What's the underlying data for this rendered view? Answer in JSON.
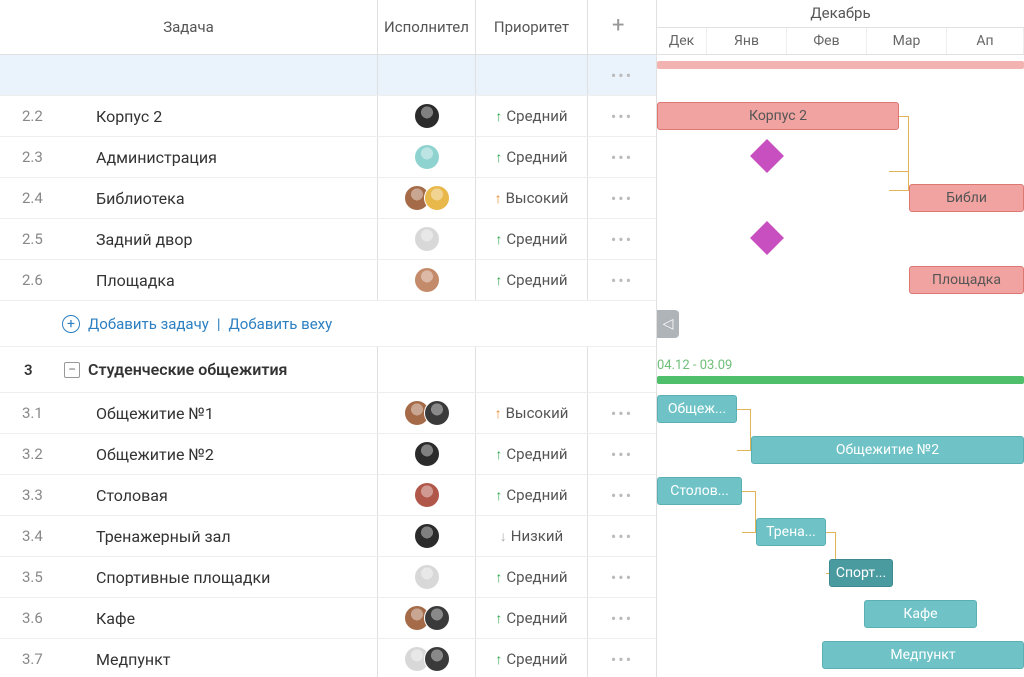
{
  "header": {
    "task": "Задача",
    "assignee": "Исполнител",
    "priority": "Приоритет",
    "month_group": "Декабрь",
    "months": [
      "Дек",
      "Янв",
      "Фев",
      "Мар",
      "Ап"
    ]
  },
  "priority_labels": {
    "high": "Высокий",
    "medium": "Средний",
    "low": "Низкий"
  },
  "rows": [
    {
      "num": "2.2",
      "name": "Корпус 2",
      "priority": "medium",
      "arrow": "green"
    },
    {
      "num": "2.3",
      "name": "Администрация",
      "priority": "medium",
      "arrow": "green"
    },
    {
      "num": "2.4",
      "name": "Библиотека",
      "priority": "high",
      "arrow": "orange"
    },
    {
      "num": "2.5",
      "name": "Задний двор",
      "priority": "medium",
      "arrow": "green"
    },
    {
      "num": "2.6",
      "name": "Площадка",
      "priority": "medium",
      "arrow": "green"
    }
  ],
  "add_links": {
    "task": "Добавить задачу",
    "milestone": "Добавить веху"
  },
  "group": {
    "num": "3",
    "name": "Студенческие общежития",
    "date_range": "04.12 - 03.09"
  },
  "rows2": [
    {
      "num": "3.1",
      "name": "Общежитие №1",
      "priority": "high",
      "arrow": "orange"
    },
    {
      "num": "3.2",
      "name": "Общежитие №2",
      "priority": "medium",
      "arrow": "green"
    },
    {
      "num": "3.3",
      "name": "Столовая",
      "priority": "medium",
      "arrow": "green"
    },
    {
      "num": "3.4",
      "name": "Тренажерный зал",
      "priority": "low",
      "arrow": "gray"
    },
    {
      "num": "3.5",
      "name": "Спортивные площадки",
      "priority": "medium",
      "arrow": "green"
    },
    {
      "num": "3.6",
      "name": "Кафе",
      "priority": "medium",
      "arrow": "green"
    },
    {
      "num": "3.7",
      "name": "Медпункт",
      "priority": "medium",
      "arrow": "green"
    }
  ],
  "gantt_bars": {
    "korpus2": "Корпус 2",
    "biblioteka": "Библи",
    "ploshadka": "Площадка",
    "obsh1": "Общеж...",
    "obsh2": "Общежитие №2",
    "stolovaya": "Столов...",
    "trenazh": "Трена...",
    "sport": "Спорт...",
    "kafe": "Кафе",
    "medpunkt": "Медпункт"
  },
  "colors": {
    "red": "#f0a3a0",
    "teal": "#6fc3c7",
    "milestone": "#c84fc0",
    "link_blue": "#2c7fc1"
  }
}
